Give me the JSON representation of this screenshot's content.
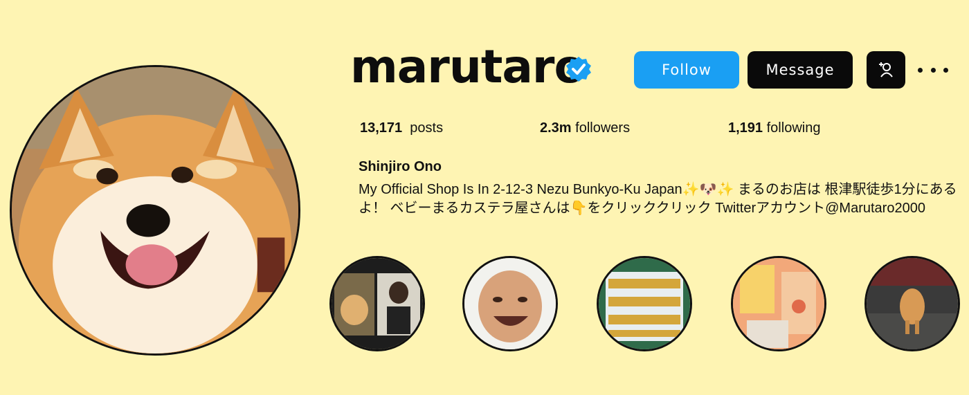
{
  "profile": {
    "username": "marutaro",
    "verified_icon": "verified-badge-icon",
    "full_name": "Shinjiro Ono",
    "bio": "My Official Shop Is In 2-12-3 Nezu Bunkyo-Ku Japan✨🐶✨ まるのお店は 根津駅徒歩1分にあるよ！ ベビーまるカステラ屋さんは👇をクリッククリック Twitterアカウント@Marutaro2000"
  },
  "actions": {
    "follow_label": "Follow",
    "message_label": "Message",
    "add_user_icon": "add-user-icon",
    "more_icon": "more-options-icon"
  },
  "stats": {
    "posts_count": "13,171",
    "posts_label": "posts",
    "followers_count": "2.3m",
    "followers_label": "followers",
    "following_count": "1,191",
    "following_label": "following"
  },
  "colors": {
    "background": "#fef4b3",
    "follow_button": "#1a9ff3",
    "message_button": "#0a0a0a",
    "verified": "#1a9ff3"
  }
}
